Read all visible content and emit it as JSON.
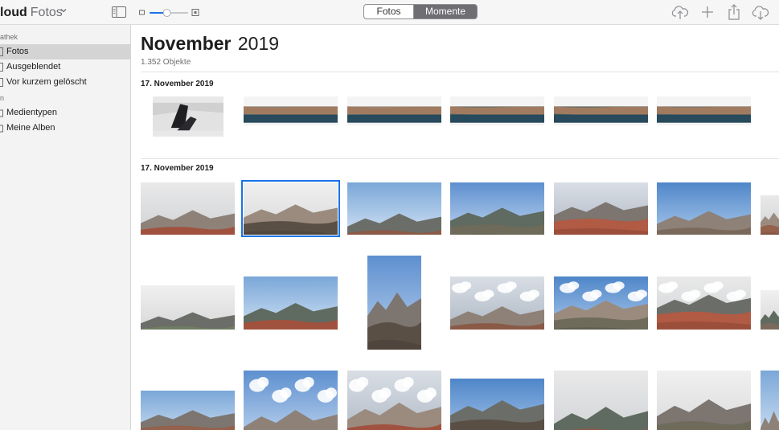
{
  "toolbar": {
    "brand": "loud",
    "product": "Fotos",
    "segments": {
      "fotos": "Fotos",
      "momente": "Momente"
    },
    "selected_segment": "Momente",
    "zoom_level": 0.45,
    "icons": [
      "sidebar-icon",
      "upload-icon",
      "add-icon",
      "share-icon",
      "download-icon"
    ]
  },
  "sidebar": {
    "section_library": "athek",
    "section_albums": "n",
    "items": [
      {
        "label": "Fotos",
        "selected": true
      },
      {
        "label": "Ausgeblendet"
      },
      {
        "label": "Vor kurzem gelöscht"
      },
      {
        "label": "Medientypen"
      },
      {
        "label": "Meine Alben"
      }
    ]
  },
  "main": {
    "month": "November",
    "year": "2019",
    "count": "1.352 Objekte",
    "moments": [
      {
        "title": "17. November 2019"
      },
      {
        "title": "17. November 2019"
      }
    ]
  },
  "colors": {
    "accent": "#1a73e8",
    "segment_selected": "#6e6e73",
    "sidebar_bg": "#f3f3f3",
    "sidebar_selected": "#d4d4d4"
  }
}
